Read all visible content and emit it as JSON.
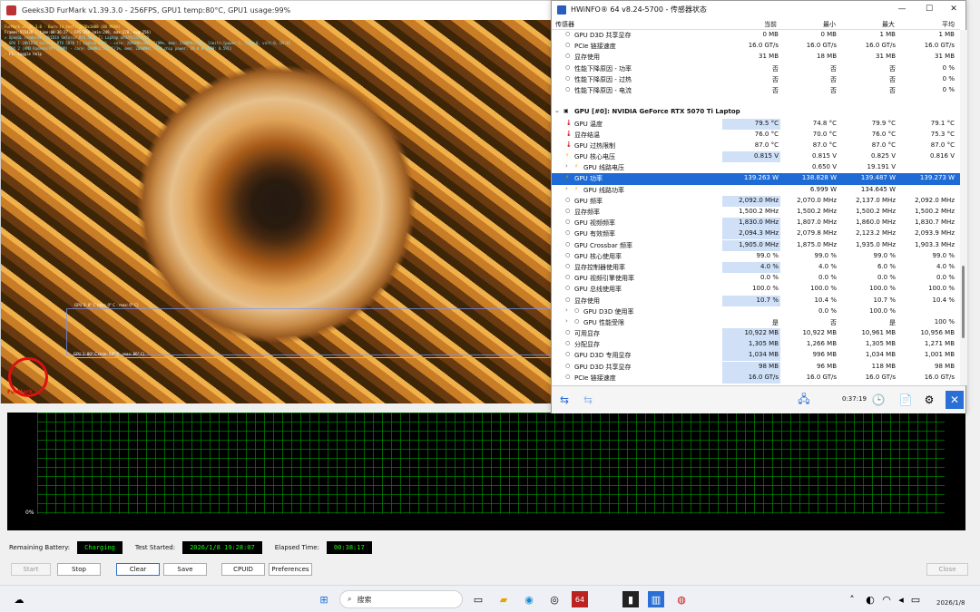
{
  "furmark": {
    "title": "Geeks3D FurMark v1.39.3.0 - 256FPS, GPU1 temp:80°C, GPU1 usage:99%",
    "hud": [
      {
        "text": "FurMark v1.39.3.0 - Burn-in test, 1920x1080 (8X MSAA)",
        "tone": "y"
      },
      {
        "text": "Frames:555426 - time:00:36:27 - FPS:256 (min:249, max:270, avg:256)",
        "tone": "w"
      },
      {
        "text": "> OpenGL renderer: NVIDIA GeForce RTX 5070 Ti Laptop GPU/PCIe/SSE2",
        "tone": "c"
      },
      {
        "text": "> GPU 1 (NVIDIA GeForce RTX 5070 Ti Laptop GPU) - core: 2092MHz/80° C/99%, mem: 1500MHz/10%, limits:[power:1, temp:0, volt:0, OV:0]",
        "tone": "c"
      },
      {
        "text": "> GPU 2 (AMD Radeon(TM) 610M) - core: 600MHz/100°C/1%, mem: 2800MHz, GPU chip power: 29.8 W (PPW: 8.591)",
        "tone": "c"
      },
      {
        "text": "- F1: toggle help",
        "tone": "w"
      }
    ],
    "gpu2_label": "GPU 2: 0° C (min: 0° C - max: 0° C)",
    "gpu1_label": "GPU 1: 80° C (min: 52° C - max: 80° C)",
    "logo_text": "FurMark",
    "monitor_zero": "0%",
    "remaining_battery_label": "Remaining Battery:",
    "remaining_battery_value": "Charging",
    "test_started_label": "Test Started:",
    "test_started_value": "2026/1/8 19:28:07",
    "elapsed_label": "Elapsed Time:",
    "elapsed_value": "00:38:17",
    "buttons": {
      "start": "Start",
      "stop": "Stop",
      "clear": "Clear",
      "save": "Save",
      "cpuid": "CPUID",
      "preferences": "Preferences",
      "close": "Close"
    }
  },
  "hwinfo": {
    "title": "HWiNFO® 64 v8.24-5700 - 传感器状态",
    "headers": [
      "传感器",
      "当前",
      "最小",
      "最大",
      "平均"
    ],
    "controls": [
      "—",
      "☐",
      "✕"
    ],
    "rows": [
      {
        "name": "GPU D3D 共享显存",
        "icon": "○",
        "vals": [
          "0 MB",
          "0 MB",
          "1 MB",
          "1 MB"
        ]
      },
      {
        "name": "PCIe 链接速度",
        "icon": "○",
        "vals": [
          "16.0 GT/s",
          "16.0 GT/s",
          "16.0 GT/s",
          "16.0 GT/s"
        ]
      },
      {
        "name": "显存使用",
        "icon": "○",
        "vals": [
          "31 MB",
          "18 MB",
          "31 MB",
          "31 MB"
        ]
      },
      {
        "name": "性能下降原因 - 功率",
        "icon": "○",
        "vals": [
          "否",
          "否",
          "否",
          "0 %"
        ]
      },
      {
        "name": "性能下降原因 - 过热",
        "icon": "○",
        "vals": [
          "否",
          "否",
          "否",
          "0 %"
        ]
      },
      {
        "name": "性能下降原因 - 电流",
        "icon": "○",
        "vals": [
          "否",
          "否",
          "否",
          "0 %"
        ]
      },
      {
        "name": "",
        "icon": "",
        "vals": [
          "",
          "",
          "",
          ""
        ],
        "spacer": true
      },
      {
        "name": "GPU [#0]: NVIDIA GeForce RTX 5070 Ti Laptop",
        "icon": "▣",
        "vals": [
          "",
          "",
          "",
          ""
        ],
        "group": true
      },
      {
        "name": "GPU 温度",
        "icon": "🌡",
        "kind": "temp",
        "vals": [
          "79.5 °C",
          "74.8 °C",
          "79.9 °C",
          "79.1 °C"
        ],
        "hl": true
      },
      {
        "name": "显存结温",
        "icon": "🌡",
        "kind": "temp",
        "vals": [
          "76.0 °C",
          "70.0 °C",
          "76.0 °C",
          "75.3 °C"
        ]
      },
      {
        "name": "GPU 过热限制",
        "icon": "🌡",
        "kind": "temp",
        "vals": [
          "87.0 °C",
          "87.0 °C",
          "87.0 °C",
          "87.0 °C"
        ]
      },
      {
        "name": "GPU 核心电压",
        "icon": "⚡",
        "kind": "bolt",
        "vals": [
          "0.815 V",
          "0.815 V",
          "0.825 V",
          "0.816 V"
        ],
        "hl": true
      },
      {
        "name": "GPU 线路电压",
        "icon": "⚡",
        "kind": "bolt",
        "vals": [
          "",
          "0.650 V",
          "19.191 V",
          ""
        ],
        "sub": true
      },
      {
        "name": "GPU 功率",
        "icon": "⚡",
        "kind": "bolt",
        "vals": [
          "139.263 W",
          "138.828 W",
          "139.487 W",
          "139.273 W"
        ],
        "selected": true
      },
      {
        "name": "GPU 线路功率",
        "icon": "⚡",
        "kind": "bolt",
        "vals": [
          "",
          "6.999 W",
          "134.645 W",
          ""
        ],
        "sub": true
      },
      {
        "name": "GPU 频率",
        "icon": "○",
        "vals": [
          "2,092.0 MHz",
          "2,070.0 MHz",
          "2,137.0 MHz",
          "2,092.0 MHz"
        ],
        "hl": true
      },
      {
        "name": "显存频率",
        "icon": "○",
        "vals": [
          "1,500.2 MHz",
          "1,500.2 MHz",
          "1,500.2 MHz",
          "1,500.2 MHz"
        ]
      },
      {
        "name": "GPU 视频频率",
        "icon": "○",
        "vals": [
          "1,830.0 MHz",
          "1,807.0 MHz",
          "1,860.0 MHz",
          "1,830.7 MHz"
        ],
        "hl": true
      },
      {
        "name": "GPU 有效频率",
        "icon": "○",
        "vals": [
          "2,094.3 MHz",
          "2,079.8 MHz",
          "2,123.2 MHz",
          "2,093.9 MHz"
        ],
        "hl": true
      },
      {
        "name": "GPU Crossbar 频率",
        "icon": "○",
        "vals": [
          "1,905.0 MHz",
          "1,875.0 MHz",
          "1,935.0 MHz",
          "1,903.3 MHz"
        ],
        "hl": true
      },
      {
        "name": "GPU 核心使用率",
        "icon": "○",
        "vals": [
          "99.0 %",
          "99.0 %",
          "99.0 %",
          "99.0 %"
        ]
      },
      {
        "name": "显存控制器使用率",
        "icon": "○",
        "vals": [
          "4.0 %",
          "4.0 %",
          "6.0 %",
          "4.0 %"
        ],
        "hl": true
      },
      {
        "name": "GPU 视频引擎使用率",
        "icon": "○",
        "vals": [
          "0.0 %",
          "0.0 %",
          "0.0 %",
          "0.0 %"
        ]
      },
      {
        "name": "GPU 总线使用率",
        "icon": "○",
        "vals": [
          "100.0 %",
          "100.0 %",
          "100.0 %",
          "100.0 %"
        ]
      },
      {
        "name": "显存使用",
        "icon": "○",
        "vals": [
          "10.7 %",
          "10.4 %",
          "10.7 %",
          "10.4 %"
        ],
        "hl": true
      },
      {
        "name": "GPU D3D 使用率",
        "icon": "○",
        "vals": [
          "",
          "0.0 %",
          "100.0 %",
          ""
        ],
        "sub": true
      },
      {
        "name": "GPU 性能受限",
        "icon": "○",
        "vals": [
          "是",
          "否",
          "是",
          "100 %"
        ],
        "sub": true
      },
      {
        "name": "可用显存",
        "icon": "○",
        "vals": [
          "10,922 MB",
          "10,922 MB",
          "10,961 MB",
          "10,956 MB"
        ],
        "hl": true
      },
      {
        "name": "分配显存",
        "icon": "○",
        "vals": [
          "1,305 MB",
          "1,266 MB",
          "1,305 MB",
          "1,271 MB"
        ],
        "hl": true
      },
      {
        "name": "GPU D3D 专用显存",
        "icon": "○",
        "vals": [
          "1,034 MB",
          "996 MB",
          "1,034 MB",
          "1,001 MB"
        ],
        "hl": true
      },
      {
        "name": "GPU D3D 共享显存",
        "icon": "○",
        "vals": [
          "98 MB",
          "96 MB",
          "118 MB",
          "98 MB"
        ],
        "hl": true
      },
      {
        "name": "PCIe 链接速度",
        "icon": "○",
        "vals": [
          "16.0 GT/s",
          "16.0 GT/s",
          "16.0 GT/s",
          "16.0 GT/s"
        ],
        "hl": true
      }
    ],
    "footer_time": "0:37:19"
  },
  "taskbar": {
    "search_placeholder": "搜索",
    "date": "2026/1/8"
  }
}
